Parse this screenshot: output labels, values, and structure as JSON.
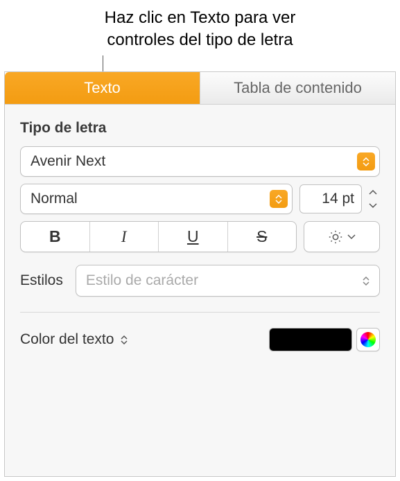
{
  "callout": {
    "line1": "Haz clic en Texto para ver",
    "line2": "controles del tipo de letra"
  },
  "tabs": {
    "text": "Texto",
    "toc": "Tabla de contenido"
  },
  "font_section": {
    "title": "Tipo de letra",
    "font_name": "Avenir Next",
    "font_style": "Normal",
    "font_size": "14 pt"
  },
  "format_buttons": {
    "bold": "B",
    "italic": "I",
    "underline": "U",
    "strike": "S"
  },
  "styles": {
    "label": "Estilos",
    "placeholder": "Estilo de carácter"
  },
  "text_color": {
    "label": "Color del texto",
    "value": "#000000"
  }
}
